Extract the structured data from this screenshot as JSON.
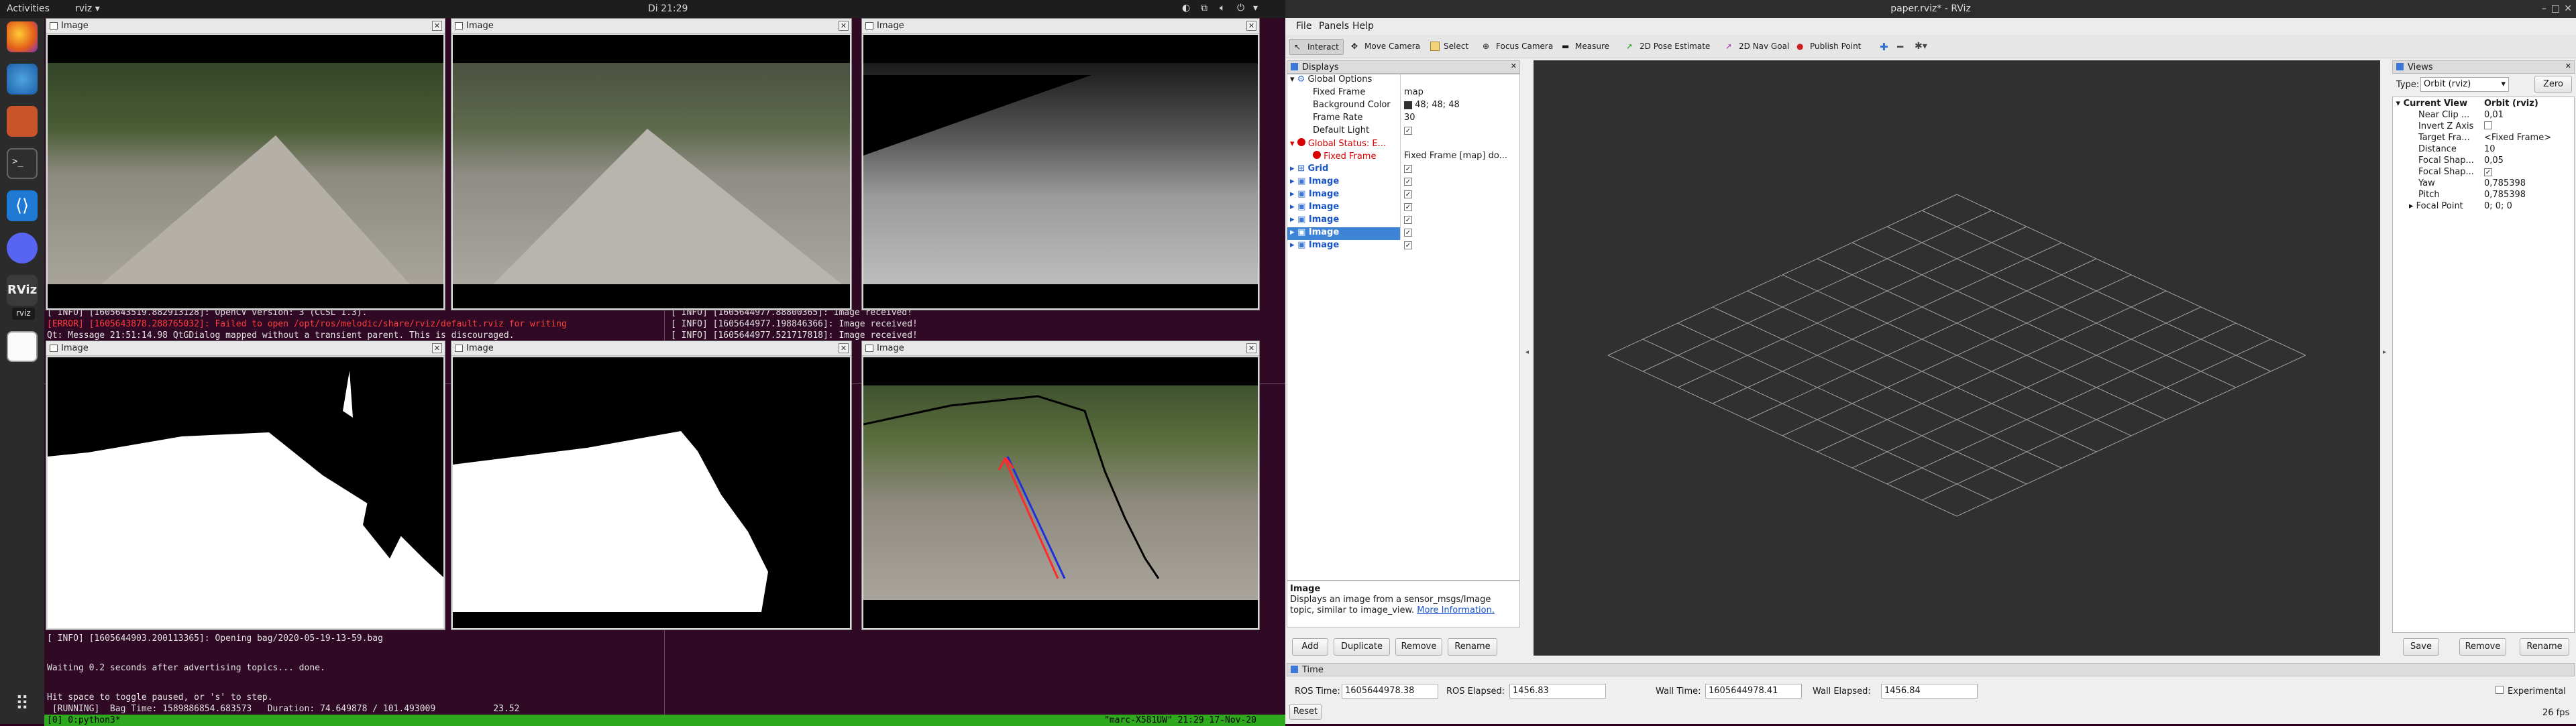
{
  "topbar": {
    "activities": "Activities",
    "app_menu": "rviz",
    "clock": "Di 21:29"
  },
  "dock": {
    "tooltip": "rviz"
  },
  "image_windows": [
    {
      "title": "Image"
    },
    {
      "title": "Image"
    },
    {
      "title": "Image"
    },
    {
      "title": "Image"
    },
    {
      "title": "Image"
    },
    {
      "title": "Image"
    }
  ],
  "terminal": {
    "lines_left": [
      "[ INFO] [1605643519.882913128]: OpenCV version: 3 (CCSL 1.3).",
      "[ERROR] [1605643878.288765032]: Failed to open /opt/ros/melodic/share/rviz/default.rviz for writing",
      "Qt: Message 21:51:14.98 QtGDialog mapped without a transient parent. This is discouraged."
    ],
    "lines_right": [
      "[ INFO] [1605644977.88800365]: Image received!",
      "[ INFO] [1605644977.198846366]: Image received!",
      "[ INFO] [1605644977.521717818]: Image received!"
    ],
    "bottom_lines": [
      "[ INFO] [1605644903.200113365]: Opening bag/2020-05-19-13-59.bag",
      "",
      "Waiting 0.2 seconds after advertising topics... done.",
      "",
      "Hit space to toggle paused, or 's' to step.",
      " [RUNNING]  Bag Time: 1589886854.683573   Duration: 74.649878 / 101.493009           23.52"
    ],
    "status_left": "[0] 0:python3*",
    "status_right": "\"marc-X581UW\" 21:29 17-Nov-20"
  },
  "rviz": {
    "title": "paper.rviz* - RViz",
    "menu": [
      "File",
      "Panels",
      "Help"
    ],
    "tools": [
      "Interact",
      "Move Camera",
      "Select",
      "Focus Camera",
      "Measure",
      "2D Pose Estimate",
      "2D Nav Goal",
      "Publish Point"
    ],
    "displays": {
      "header": "Displays",
      "global_options": "Global Options",
      "props": [
        {
          "name": "Fixed Frame",
          "value": "map"
        },
        {
          "name": "Background Color",
          "value": "48; 48; 48"
        },
        {
          "name": "Frame Rate",
          "value": "30"
        },
        {
          "name": "Default Light",
          "value": ""
        }
      ],
      "global_status": "Global Status: E...",
      "fixed_frame_err": "Fixed Frame",
      "fixed_frame_err_value": "Fixed Frame [map] do...",
      "items": [
        "Grid",
        "Image",
        "Image",
        "Image",
        "Image",
        "Image",
        "Image"
      ],
      "desc_title": "Image",
      "desc_text": "Displays an image from a sensor_msgs/Image topic, similar to image_view.",
      "desc_link": "More Information.",
      "buttons": [
        "Add",
        "Duplicate",
        "Remove",
        "Rename"
      ]
    },
    "views": {
      "header": "Views",
      "type_label": "Type:",
      "type_value": "Orbit (rviz)",
      "zero": "Zero",
      "current_view": "Current View",
      "current_view_value": "Orbit (rviz)",
      "props": [
        {
          "name": "Near Clip ...",
          "value": "0,01"
        },
        {
          "name": "Invert Z Axis",
          "value": ""
        },
        {
          "name": "Target Fra...",
          "value": "<Fixed Frame>"
        },
        {
          "name": "Distance",
          "value": "10"
        },
        {
          "name": "Focal Shap...",
          "value": "0,05"
        },
        {
          "name": "Focal Shap...",
          "value": ""
        },
        {
          "name": "Yaw",
          "value": "0,785398"
        },
        {
          "name": "Pitch",
          "value": "0,785398"
        },
        {
          "name": "Focal Point",
          "value": "0; 0; 0"
        }
      ],
      "buttons": [
        "Save",
        "Remove",
        "Rename"
      ]
    },
    "time": {
      "header": "Time",
      "ros_time_label": "ROS Time:",
      "ros_time": "1605644978.38",
      "ros_elapsed_label": "ROS Elapsed:",
      "ros_elapsed": "1456.83",
      "wall_time_label": "Wall Time:",
      "wall_time": "1605644978.41",
      "wall_elapsed_label": "Wall Elapsed:",
      "wall_elapsed": "1456.84",
      "experimental": "Experimental",
      "reset": "Reset",
      "fps": "26 fps"
    },
    "colors": {
      "viewport_bg": "#303030",
      "grid": "#a0a0a0",
      "error_red": "#d80000",
      "link_blue": "#1a56c8"
    }
  }
}
